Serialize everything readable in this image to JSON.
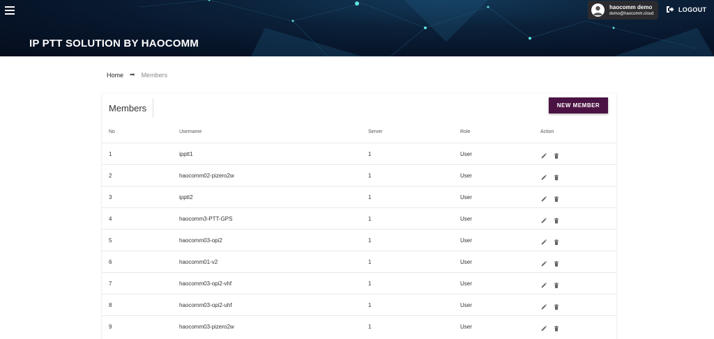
{
  "header": {
    "app_title": "IP PTT SOLUTION BY HAOCOMM",
    "user": {
      "name": "haocomm demo",
      "email": "demo@haocomm.cloud"
    },
    "logout_label": "LOGOUT"
  },
  "breadcrumb": {
    "home": "Home",
    "current": "Members"
  },
  "members": {
    "title": "Members",
    "new_button": "NEW MEMBER",
    "columns": {
      "no": "No",
      "username": "Username",
      "server": "Server",
      "role": "Role",
      "action": "Action"
    },
    "rows": [
      {
        "no": "1",
        "username": "ipptt1",
        "server": "1",
        "role": "User"
      },
      {
        "no": "2",
        "username": "haocomm02-pizero2w",
        "server": "1",
        "role": "User"
      },
      {
        "no": "3",
        "username": "ipptt2",
        "server": "1",
        "role": "User"
      },
      {
        "no": "4",
        "username": "haocomm3-PTT-GPS",
        "server": "1",
        "role": "User"
      },
      {
        "no": "5",
        "username": "haocomm03-opi2",
        "server": "1",
        "role": "User"
      },
      {
        "no": "6",
        "username": "haocomm01-v2",
        "server": "1",
        "role": "User"
      },
      {
        "no": "7",
        "username": "haocomm03-opi2-vhf",
        "server": "1",
        "role": "User"
      },
      {
        "no": "8",
        "username": "haocomm03-opi2-uhf",
        "server": "1",
        "role": "User"
      },
      {
        "no": "9",
        "username": "haocomm03-pizero2w",
        "server": "1",
        "role": "User"
      }
    ]
  },
  "icons": {
    "menu": "menu-icon",
    "avatar": "user-avatar-icon",
    "logout": "logout-icon",
    "breadcrumb_separator": "arrow-right-icon",
    "edit": "pencil-icon",
    "delete": "trash-icon"
  },
  "colors": {
    "header_bg": "#07152a",
    "user_box": "#2b2b2f",
    "primary_button": "#4b1343"
  }
}
